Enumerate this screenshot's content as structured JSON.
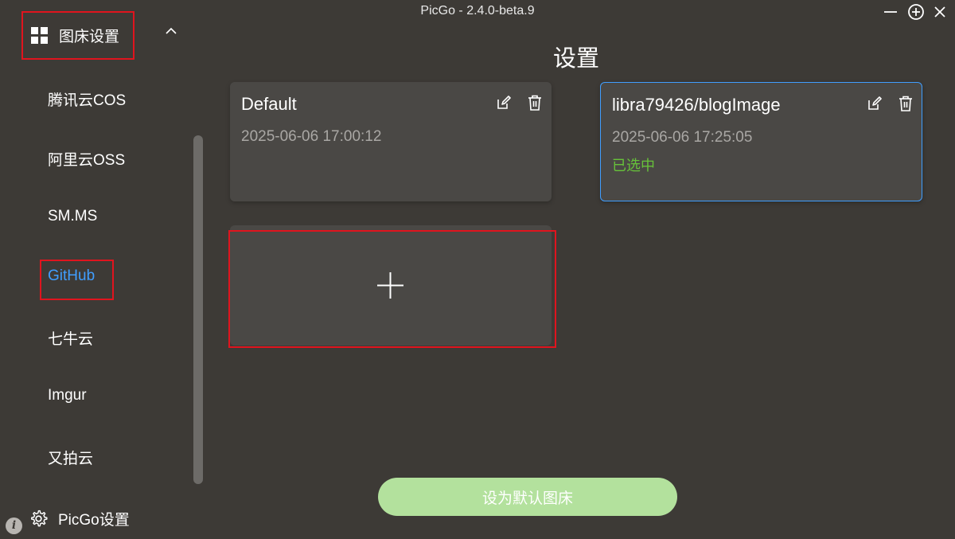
{
  "window": {
    "title": "PicGo - 2.4.0-beta.9",
    "controls": [
      "minimize-icon",
      "maximize-icon",
      "close-icon"
    ]
  },
  "sidebar": {
    "section_label": "图床设置",
    "section_icon": "grid-icon",
    "items": [
      {
        "label": "腾讯云COS",
        "active": false
      },
      {
        "label": "阿里云OSS",
        "active": false
      },
      {
        "label": "SM.MS",
        "active": false
      },
      {
        "label": "GitHub",
        "active": true
      },
      {
        "label": "七牛云",
        "active": false
      },
      {
        "label": "Imgur",
        "active": false
      },
      {
        "label": "又拍云",
        "active": false
      }
    ],
    "settings_label": "PicGo设置",
    "settings_icon": "gear-icon",
    "info_glyph": "i"
  },
  "main": {
    "title": "设置",
    "configs": [
      {
        "name": "Default",
        "time": "2025-06-06 17:00:12",
        "status": ""
      },
      {
        "name": "libra79426/blogImage",
        "time": "2025-06-06 17:25:05",
        "status": "已选中"
      }
    ],
    "add_icon": "plus-icon",
    "default_button_label": "设为默认图床"
  },
  "colors": {
    "background": "#3d3a36",
    "card": "#4a4845",
    "accent_blue": "#409eff",
    "selected_green": "#67c23a",
    "button_green": "#b3e19d",
    "highlight_red": "#e0141e"
  }
}
